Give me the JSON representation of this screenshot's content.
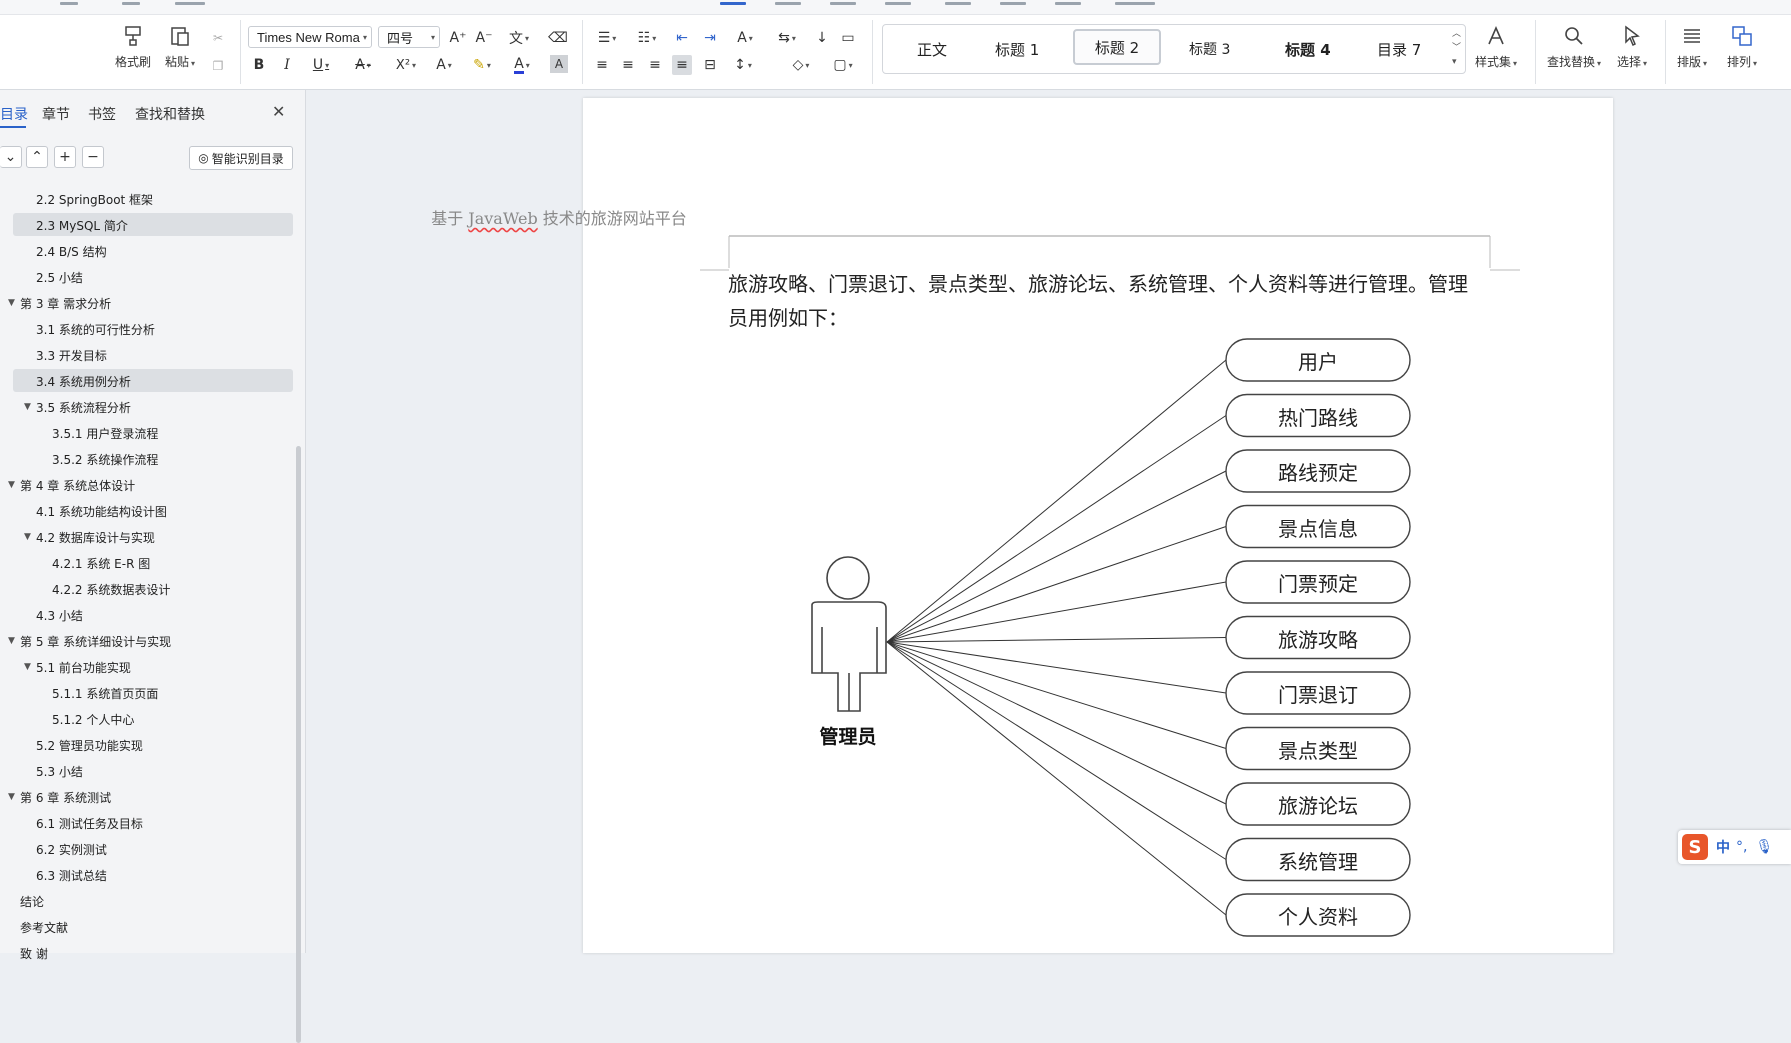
{
  "ribbon": {
    "clipboard": {
      "format_painter": "格式刷",
      "paste": "粘贴"
    },
    "font_name": "Times New Roma",
    "font_size": "四号",
    "styles": [
      "正文",
      "标题 1",
      "标题 2",
      "标题 3",
      "标题 4",
      "目录 7"
    ],
    "selected_style": "标题 2",
    "style_set": "样式集",
    "find_replace": "查找替换",
    "select": "选择",
    "layout": "排版",
    "arrange": "排列"
  },
  "nav": {
    "tabs": [
      "目录",
      "章节",
      "书签",
      "查找和替换"
    ],
    "active_tab": "目录",
    "smart_btn": "智能识别目录",
    "toc": [
      {
        "label": "2.2 SpringBoot 框架",
        "level": 2
      },
      {
        "label": "2.3 MySQL 简介",
        "level": 2,
        "highlight": true
      },
      {
        "label": "2.4 B/S 结构",
        "level": 2
      },
      {
        "label": "2.5 小结",
        "level": 2
      },
      {
        "label": "第 3 章  需求分析",
        "level": 1,
        "expand": true
      },
      {
        "label": "3.1 系统的可行性分析",
        "level": 2
      },
      {
        "label": "3.3 开发目标",
        "level": 2
      },
      {
        "label": "3.4  系统用例分析",
        "level": 2,
        "highlight": true
      },
      {
        "label": "3.5 系统流程分析",
        "level": 2,
        "expand": true
      },
      {
        "label": "3.5.1  用户登录流程",
        "level": 3
      },
      {
        "label": "3.5.2  系统操作流程",
        "level": 3
      },
      {
        "label": "第 4 章  系统总体设计",
        "level": 1,
        "expand": true
      },
      {
        "label": "4.1 系统功能结构设计图",
        "level": 2
      },
      {
        "label": "4.2  数据库设计与实现",
        "level": 2,
        "expand": true
      },
      {
        "label": "4.2.1  系统 E-R 图",
        "level": 3
      },
      {
        "label": "4.2.2  系统数据表设计",
        "level": 3
      },
      {
        "label": "4.3 小结",
        "level": 2
      },
      {
        "label": "第 5 章  系统详细设计与实现",
        "level": 1,
        "expand": true
      },
      {
        "label": "5.1 前台功能实现",
        "level": 2,
        "expand": true
      },
      {
        "label": "5.1.1 系统首页页面",
        "level": 3
      },
      {
        "label": "5.1.2 个人中心",
        "level": 3
      },
      {
        "label": "5.2 管理员功能实现",
        "level": 2
      },
      {
        "label": "5.3  小结",
        "level": 2
      },
      {
        "label": "第 6 章  系统测试",
        "level": 1,
        "expand": true
      },
      {
        "label": "6.1  测试任务及目标",
        "level": 2
      },
      {
        "label": "6.2    实例测试",
        "level": 2
      },
      {
        "label": "6.3    测试总结",
        "level": 2
      },
      {
        "label": "结论",
        "level": 1
      },
      {
        "label": "参考文献",
        "level": 1
      },
      {
        "label": "致    谢",
        "level": 1
      }
    ]
  },
  "document": {
    "header": "基于 JavaWeb 技术的旅游网站平台",
    "header_underlined": "JavaWeb",
    "body_line1": "旅游攻略、门票退订、景点类型、旅游论坛、系统管理、个人资料等进行管理。管理",
    "body_line2": "员用例如下：",
    "actor": "管理员",
    "use_cases": [
      "用户",
      "热门路线",
      "路线预定",
      "景点信息",
      "门票预定",
      "旅游攻略",
      "门票退订",
      "景点类型",
      "旅游论坛",
      "系统管理",
      "个人资料"
    ]
  },
  "ime": {
    "logo": "S",
    "mode": "中",
    "punct": "°,"
  }
}
